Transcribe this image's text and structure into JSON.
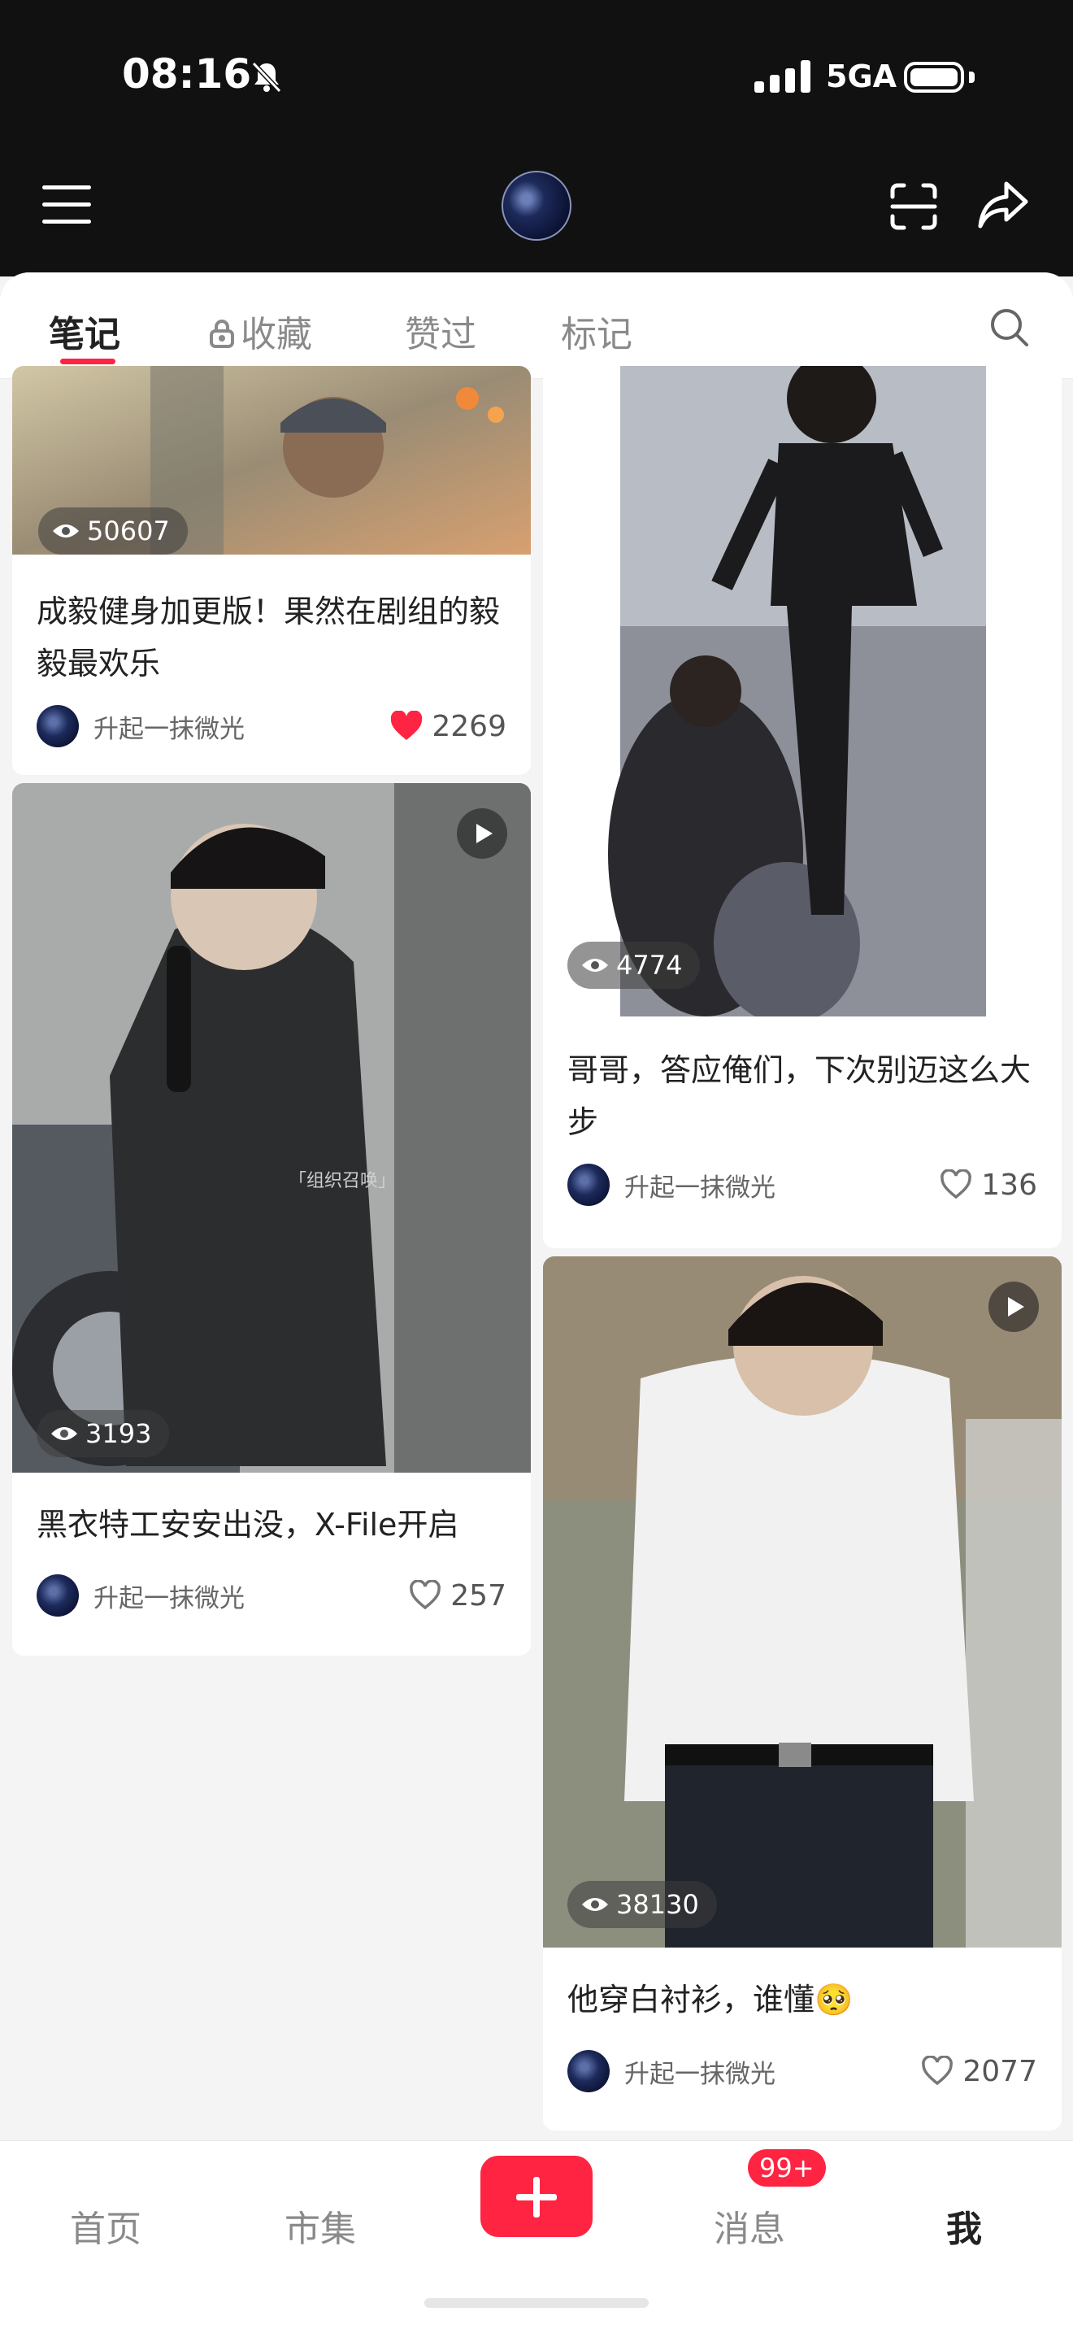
{
  "status_bar": {
    "time": "08:16",
    "network": "5GA"
  },
  "tabs": [
    {
      "label": "笔记"
    },
    {
      "label": "收藏"
    },
    {
      "label": "赞过"
    },
    {
      "label": "标记"
    }
  ],
  "notes": [
    {
      "views": "50607",
      "title": "成毅健身加更版！果然在剧组的毅毅最欢乐",
      "author": "升起一抹微光",
      "likes": "2269",
      "liked": true
    },
    {
      "views": "4774",
      "title": "哥哥，答应俺们，下次别迈这么大步",
      "author": "升起一抹微光",
      "likes": "136",
      "liked": false
    },
    {
      "views": "3193",
      "title": "黑衣特工安安出没，X-File开启",
      "author": "升起一抹微光",
      "likes": "257",
      "liked": false,
      "overlay_text": "「组织召唤」"
    },
    {
      "views": "38130",
      "title": "他穿白衬衫，谁懂🥺",
      "author": "升起一抹微光",
      "likes": "2077",
      "liked": false
    }
  ],
  "bottom_nav": [
    {
      "label": "首页"
    },
    {
      "label": "市集"
    },
    {
      "label": "消息",
      "badge": "99+"
    },
    {
      "label": "我"
    }
  ],
  "colors": {
    "accent": "#ff2442",
    "background": "#f4f4f5"
  }
}
